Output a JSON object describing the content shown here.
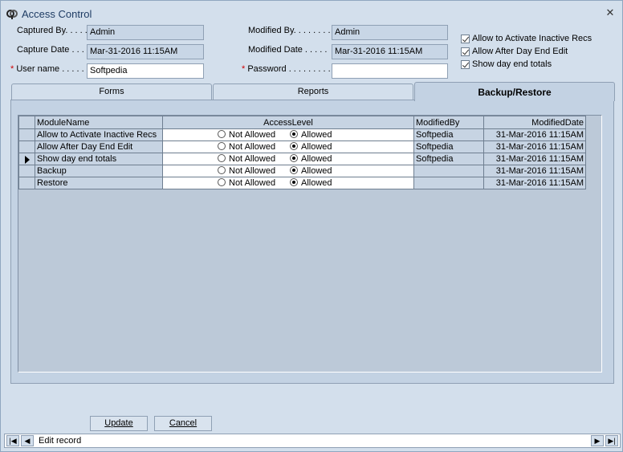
{
  "window": {
    "title": "Access Control",
    "close": "✕"
  },
  "form": {
    "captured_by_label": "Captured By. . . . .",
    "captured_by": "Admin",
    "capture_date_label": "Capture Date . . . .",
    "capture_date": "Mar-31-2016 11:15AM",
    "username_label": "User name . . . . . .",
    "username": "Softpedia",
    "modified_by_label": "Modified By. . . . . . . .",
    "modified_by": "Admin",
    "modified_date_label": "Modified Date . . . . .",
    "modified_date": "Mar-31-2016 11:15AM",
    "password_label": "Password . . . . . . . . .",
    "password": "",
    "required_mark": "*"
  },
  "options": [
    {
      "label": "Allow to Activate Inactive Recs",
      "checked": true
    },
    {
      "label": "Allow After Day End Edit",
      "checked": true
    },
    {
      "label": "Show day end totals",
      "checked": true
    }
  ],
  "tabs": [
    {
      "label": "Forms",
      "active": false
    },
    {
      "label": "Reports",
      "active": false
    },
    {
      "label": "Backup/Restore",
      "active": true
    }
  ],
  "grid": {
    "headers": {
      "module": "ModuleName",
      "access": "AccessLevel",
      "by": "ModifiedBy",
      "date": "ModifiedDate"
    },
    "option_not_allowed": "Not Allowed",
    "option_allowed": "Allowed",
    "rows": [
      {
        "module": "Allow to Activate Inactive Recs",
        "access": "Allowed",
        "by": "Softpedia",
        "date": "31-Mar-2016 11:15AM",
        "current": false
      },
      {
        "module": "Allow After Day End Edit",
        "access": "Allowed",
        "by": "Softpedia",
        "date": "31-Mar-2016 11:15AM",
        "current": false
      },
      {
        "module": "Show day end totals",
        "access": "Allowed",
        "by": "Softpedia",
        "date": "31-Mar-2016 11:15AM",
        "current": true
      },
      {
        "module": "Backup",
        "access": "Allowed",
        "by": "",
        "date": "31-Mar-2016 11:15AM",
        "current": false
      },
      {
        "module": "Restore",
        "access": "Allowed",
        "by": "",
        "date": "31-Mar-2016 11:15AM",
        "current": false
      }
    ]
  },
  "buttons": {
    "update": "Update",
    "cancel": "Cancel"
  },
  "status": {
    "text": "Edit record"
  },
  "icons": {
    "app": "keys-icon",
    "first": "first-record-icon",
    "prev": "previous-record-icon",
    "next": "next-record-icon",
    "last": "last-record-icon"
  }
}
